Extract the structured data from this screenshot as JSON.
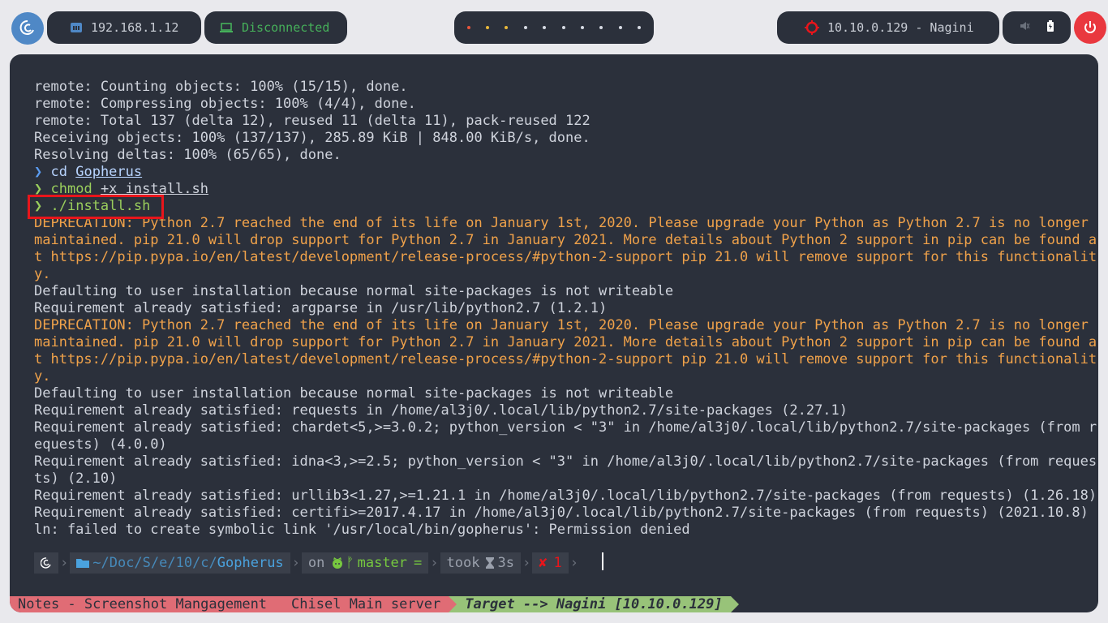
{
  "topbar": {
    "ip": "192.168.1.12",
    "vpn_status": "Disconnected",
    "workspaces": [
      "red",
      "yellow",
      "yellow",
      "white",
      "white",
      "white",
      "white",
      "white",
      "white",
      "white"
    ],
    "target": "10.10.0.129 - Nagini",
    "icons": [
      "debian-logo-icon",
      "ethernet-icon",
      "laptop-icon",
      "target-icon",
      "mute-icon",
      "battery-icon",
      "power-icon"
    ],
    "colors": {
      "accent": "#4f88c6",
      "vpn": "#46b05a",
      "power": "#e9383f",
      "target_icon": "#e8151b"
    }
  },
  "terminal": {
    "lines": [
      {
        "type": "normal",
        "text": "remote: Counting objects: 100% (15/15), done."
      },
      {
        "type": "normal",
        "text": "remote: Compressing objects: 100% (4/4), done."
      },
      {
        "type": "normal",
        "text": "remote: Total 137 (delta 12), reused 11 (delta 11), pack-reused 122"
      },
      {
        "type": "normal",
        "text": "Receiving objects: 100% (137/137), 285.89 KiB | 848.00 KiB/s, done."
      },
      {
        "type": "normal",
        "text": "Resolving deltas: 100% (65/65), done."
      }
    ],
    "cmd1": {
      "arrow": "❯",
      "cmd": "cd",
      "arg": "Gopherus"
    },
    "cmd2": {
      "arrow": "❯",
      "cmd": "chmod",
      "arg": "+x install.sh"
    },
    "cmd3": {
      "arrow": "❯",
      "cmd": "./install.sh"
    },
    "out": [
      {
        "type": "warn",
        "text": "DEPRECATION: Python 2.7 reached the end of its life on January 1st, 2020. Please upgrade your Python as Python 2.7 is no longer"
      },
      {
        "type": "warn",
        "text": "maintained. pip 21.0 will drop support for Python 2.7 in January 2021. More details about Python 2 support in pip can be found a"
      },
      {
        "type": "warn",
        "text": "t https://pip.pypa.io/en/latest/development/release-process/#python-2-support pip 21.0 will remove support for this functionalit"
      },
      {
        "type": "warn",
        "text": "y."
      },
      {
        "type": "normal",
        "text": "Defaulting to user installation because normal site-packages is not writeable"
      },
      {
        "type": "normal",
        "text": "Requirement already satisfied: argparse in /usr/lib/python2.7 (1.2.1)"
      },
      {
        "type": "warn",
        "text": "DEPRECATION: Python 2.7 reached the end of its life on January 1st, 2020. Please upgrade your Python as Python 2.7 is no longer"
      },
      {
        "type": "warn",
        "text": "maintained. pip 21.0 will drop support for Python 2.7 in January 2021. More details about Python 2 support in pip can be found a"
      },
      {
        "type": "warn",
        "text": "t https://pip.pypa.io/en/latest/development/release-process/#python-2-support pip 21.0 will remove support for this functionalit"
      },
      {
        "type": "warn",
        "text": "y."
      },
      {
        "type": "normal",
        "text": "Defaulting to user installation because normal site-packages is not writeable"
      },
      {
        "type": "normal",
        "text": "Requirement already satisfied: requests in /home/al3j0/.local/lib/python2.7/site-packages (2.27.1)"
      },
      {
        "type": "normal",
        "text": "Requirement already satisfied: chardet<5,>=3.0.2; python_version < \"3\" in /home/al3j0/.local/lib/python2.7/site-packages (from r"
      },
      {
        "type": "normal",
        "text": "equests) (4.0.0)"
      },
      {
        "type": "normal",
        "text": "Requirement already satisfied: idna<3,>=2.5; python_version < \"3\" in /home/al3j0/.local/lib/python2.7/site-packages (from reques"
      },
      {
        "type": "normal",
        "text": "ts) (2.10)"
      },
      {
        "type": "normal",
        "text": "Requirement already satisfied: urllib3<1.27,>=1.21.1 in /home/al3j0/.local/lib/python2.7/site-packages (from requests) (1.26.18)"
      },
      {
        "type": "normal",
        "text": "Requirement already satisfied: certifi>=2017.4.17 in /home/al3j0/.local/lib/python2.7/site-packages (from requests) (2021.10.8)"
      },
      {
        "type": "normal",
        "text": "ln: failed to create symbolic link '/usr/local/bin/gopherus': Permission denied"
      }
    ]
  },
  "prompt": {
    "path_prefix": "~/Doc/S/e/10/c/",
    "path_dir": "Gopherus",
    "on": "on",
    "branch": "master",
    "branch_state": "=",
    "took": "took",
    "duration": "3s",
    "exit_mark": "✘",
    "exit_code": "1"
  },
  "status_bar": {
    "tab1": "Notes - Screenshot Mangagement",
    "tab2": "Chisel Main server",
    "tab3": "Target --> Nagini [10.10.0.129]"
  },
  "colors": {
    "warning": "#f0a24a",
    "prompt_blue": "#5b9cf0",
    "prompt_green": "#9ace5c",
    "status_red": "#e06c75",
    "status_green": "#98c379",
    "highlight": "#e8151b"
  }
}
